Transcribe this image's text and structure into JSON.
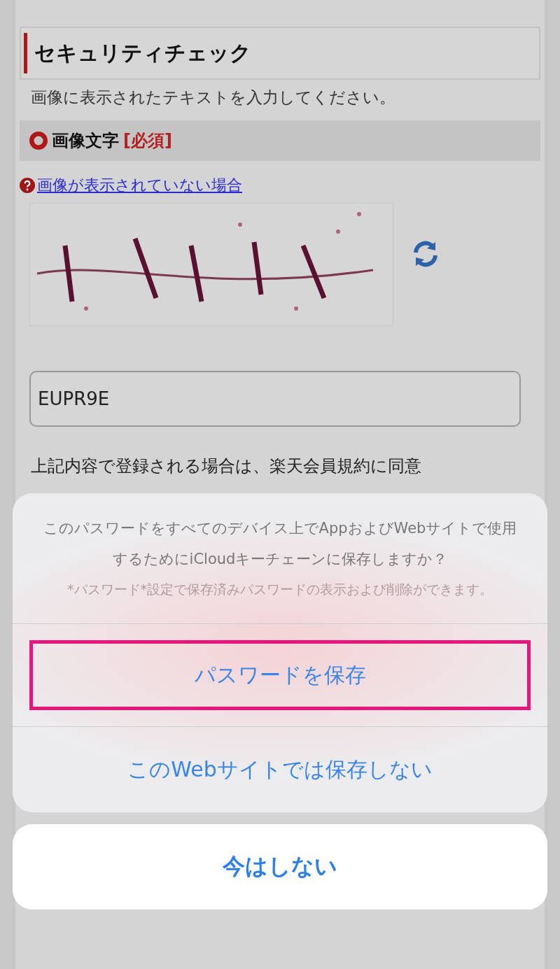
{
  "page": {
    "title": "セキュリティチェック",
    "instruction": "画像に表示されたテキストを入力してください。",
    "field_header": {
      "label": "画像文字",
      "required": "[必須]"
    },
    "help_link": "画像が表示されていない場合",
    "answer": {
      "value": "EUPR9E"
    },
    "agreement": "上記内容で登録される場合は、楽天会員規約に同意"
  },
  "sheet": {
    "message": "このパスワードをすべてのデバイス上でAppおよびWebサイトで使用するためにiCloudキーチェーンに保存しますか？",
    "note": "*パスワード*設定で保存済みパスワードの表示および削除ができます。",
    "actions": [
      {
        "label": "パスワードを保存",
        "highlighted": true
      },
      {
        "label": "このWebサイトでは保存しない",
        "highlighted": false
      }
    ],
    "cancel": "今はしない"
  }
}
